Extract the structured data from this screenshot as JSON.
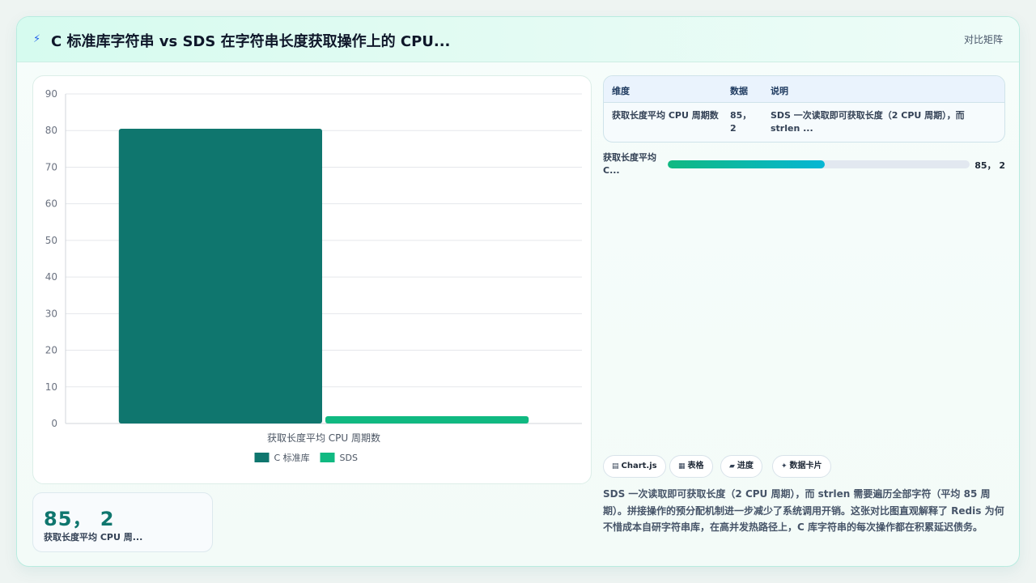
{
  "header": {
    "icon": "lightning-icon",
    "title": "C 标准库字符串 vs SDS 在字符串长度获取操作上的 CPU...",
    "view_label": "对比矩阵"
  },
  "chart_data": {
    "type": "bar",
    "categories": [
      "获取长度平均 CPU 周期数"
    ],
    "series": [
      {
        "name": "C 标准库",
        "values": [
          80.5
        ],
        "color": "#0f766e"
      },
      {
        "name": "SDS",
        "values": [
          2
        ],
        "color": "#10b981"
      }
    ],
    "ylim": [
      0,
      90
    ],
    "yticks": [
      0,
      10,
      20,
      30,
      40,
      50,
      60,
      70,
      80,
      90
    ],
    "grid": true,
    "legend": "bottom"
  },
  "stat_card": {
    "value": "85， 2",
    "label": "获取长度平均 CPU 周..."
  },
  "table": {
    "headers": [
      "维度",
      "数据",
      "说明"
    ],
    "rows": [
      {
        "dimension": "获取长度平均 CPU 周期数",
        "data": "85， 2",
        "note": "SDS 一次读取即可获取长度（2 CPU 周期），而 strlen ..."
      }
    ]
  },
  "progress": {
    "label": "获取长度平均 C...",
    "value_text": "85， 2",
    "fraction": 0.52
  },
  "tabs": [
    {
      "icon": "chart-icon",
      "glyph": "▤",
      "label": "Chart.js"
    },
    {
      "icon": "table-icon",
      "glyph": "▦",
      "label": "表格"
    },
    {
      "icon": "progress-icon",
      "glyph": "▰",
      "label": "进度"
    },
    {
      "icon": "sparkle-icon",
      "glyph": "✦",
      "label": "数据卡片"
    }
  ],
  "description": "SDS 一次读取即可获取长度（2 CPU 周期），而 strlen 需要遍历全部字符（平均 85 周期）。拼接操作的预分配机制进一步减少了系统调用开销。这张对比图直观解释了 Redis 为何不惜成本自研字符串库，在高并发热路径上，C 库字符串的每次操作都在积累延迟债务。"
}
